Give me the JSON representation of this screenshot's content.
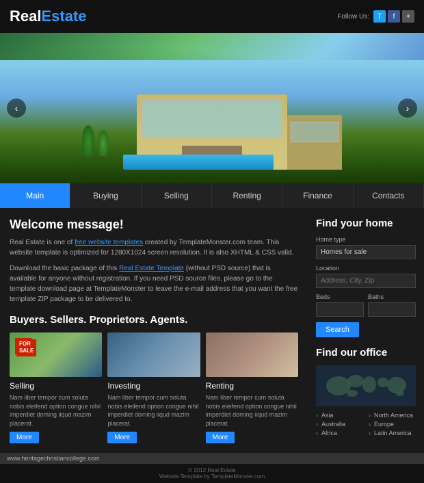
{
  "header": {
    "logo_real": "Real",
    "logo_estate": "Estate",
    "follow_label": "Follow Us:",
    "social": [
      "T",
      "f",
      "+"
    ]
  },
  "nav": {
    "items": [
      "Main",
      "Buying",
      "Selling",
      "Renting",
      "Finance",
      "Contacts"
    ],
    "active": "Main"
  },
  "hero": {
    "arrow_left": "‹",
    "arrow_right": "›"
  },
  "welcome": {
    "title": "Welcome message!",
    "text1": "Real Estate is one of ",
    "link1": "free website templates",
    "text2": " created by TemplateMonster.com team. This website template is optimized for 1280X1024 screen resolution. It is also XHTML & CSS valid.",
    "text3": "Download the basic package of this ",
    "link2": "Real Estate Template",
    "text4": " (without PSD source) that is available for anyone without registration. If you need PSD source files, please go to the template download page at TemplateMonster to leave the e-mail address that you want the free template ZIP package to be delivered to."
  },
  "section": {
    "title": "Buyers. Sellers. Proprietors. Agents."
  },
  "cards": [
    {
      "type": "sell",
      "title": "Selling",
      "text": "Nam liber tempor cum soluta nobis eleifend option congue nihil imperdiet doming iiqud mazim placerat.",
      "btn": "More"
    },
    {
      "type": "invest",
      "title": "Investing",
      "text": "Nam liber tempor cum soluta nobis eleifend option congue nihil imperdiet doming iiqud mazim placerat.",
      "btn": "More"
    },
    {
      "type": "rent",
      "title": "Renting",
      "text": "Nam liber tempor cum soluta nobis eleifend option congue nihil imperdiet doming iiqud mazim placerat.",
      "btn": "More"
    }
  ],
  "sidebar": {
    "find_title": "Find your home",
    "home_type_label": "Home type",
    "home_type_value": "Homes for sale",
    "location_label": "Location",
    "location_placeholder": "Address, City, Zip",
    "beds_label": "Beds",
    "baths_label": "Baths",
    "search_btn": "Search",
    "office_title": "Find our office",
    "regions": [
      {
        "col": 1,
        "name": "Asia"
      },
      {
        "col": 1,
        "name": "Australia"
      },
      {
        "col": 1,
        "name": "Africa"
      },
      {
        "col": 2,
        "name": "North America"
      },
      {
        "col": 2,
        "name": "Europe"
      },
      {
        "col": 2,
        "name": "Latin America"
      }
    ]
  },
  "footer": {
    "url": "www.heritagechristiancollege.com",
    "copyright": "© 2012 Real Estate",
    "credit": "Website Template by TemplateMonster.com"
  }
}
